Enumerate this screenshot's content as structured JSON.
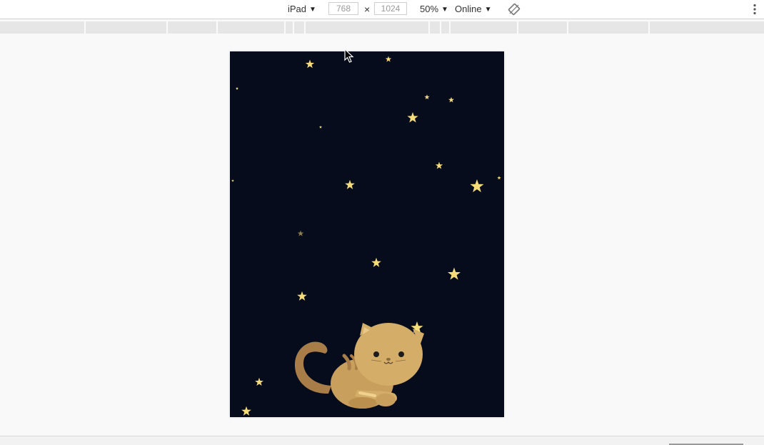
{
  "toolbar": {
    "device_name": "iPad",
    "width_value": "768",
    "dimension_separator": "×",
    "height_value": "1024",
    "zoom_label": "50%",
    "network_label": "Online",
    "dropdown_icon": "caret-down-icon",
    "rotate_icon": "rotate-icon",
    "more_icon": "more-vertical-icon"
  },
  "colors": {
    "viewport_bg": "#060c1b",
    "star_fill": "#f6dc78",
    "cat_body": "#d4ad68",
    "cat_shadow": "#bb8f4e",
    "cat_tail": "#a97d48",
    "cat_eyes": "#1c1c1c"
  },
  "viewport": {
    "scene_icons": [
      "star-icon",
      "cat-illustration"
    ]
  }
}
